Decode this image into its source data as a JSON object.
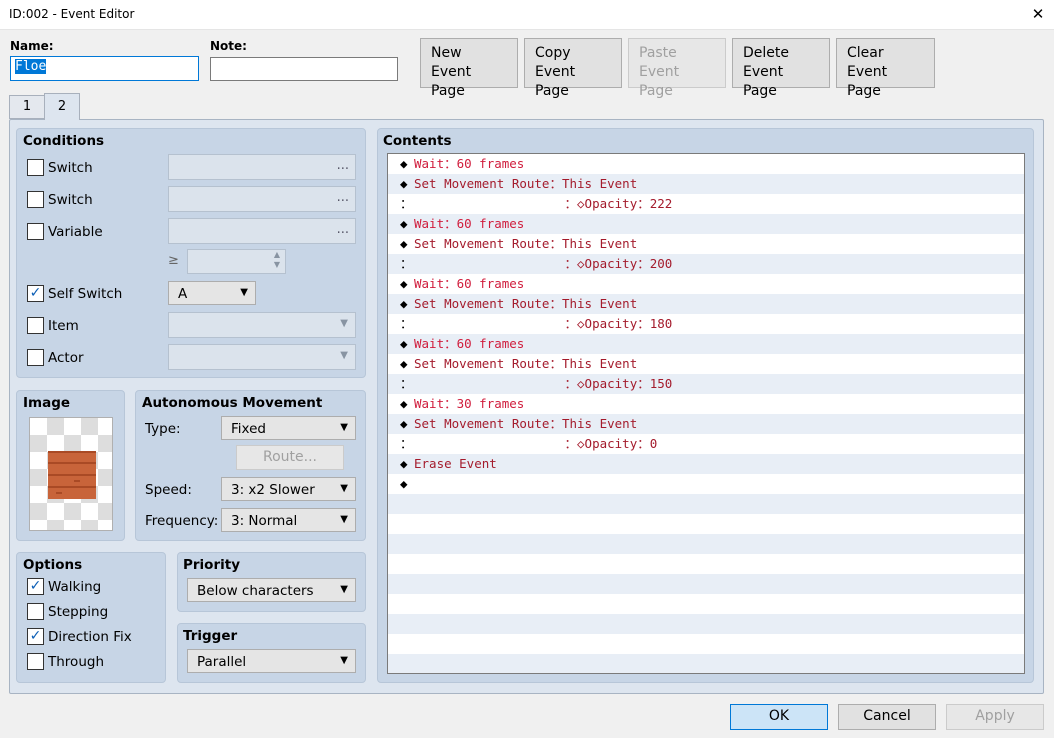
{
  "window": {
    "title": "ID:002 - Event Editor",
    "close_glyph": "✕"
  },
  "name": {
    "label": "Name:",
    "value": "Floe"
  },
  "note": {
    "label": "Note:",
    "value": ""
  },
  "toolbar": {
    "new": [
      "New",
      "Event Page"
    ],
    "copy": [
      "Copy",
      "Event Page"
    ],
    "paste": [
      "Paste",
      "Event Page"
    ],
    "delete": [
      "Delete",
      "Event Page"
    ],
    "clear": [
      "Clear",
      "Event Page"
    ]
  },
  "tabs": [
    "1",
    "2"
  ],
  "conditions": {
    "title": "Conditions",
    "switch1": {
      "label": "Switch",
      "checked": false
    },
    "switch2": {
      "label": "Switch",
      "checked": false
    },
    "variable": {
      "label": "Variable",
      "checked": false
    },
    "ge_symbol": "≥",
    "self_switch": {
      "label": "Self Switch",
      "checked": true,
      "value": "A"
    },
    "item": {
      "label": "Item",
      "checked": false
    },
    "actor": {
      "label": "Actor",
      "checked": false
    },
    "ellipsis": "..."
  },
  "image": {
    "title": "Image"
  },
  "autonomous": {
    "title": "Autonomous Movement",
    "type_label": "Type:",
    "type_value": "Fixed",
    "route_label": "Route...",
    "speed_label": "Speed:",
    "speed_value": "3: x2 Slower",
    "freq_label": "Frequency:",
    "freq_value": "3: Normal"
  },
  "options": {
    "title": "Options",
    "walking": {
      "label": "Walking",
      "checked": true
    },
    "stepping": {
      "label": "Stepping",
      "checked": false
    },
    "direction_fix": {
      "label": "Direction Fix",
      "checked": true
    },
    "through": {
      "label": "Through",
      "checked": false
    }
  },
  "priority": {
    "title": "Priority",
    "value": "Below characters"
  },
  "trigger": {
    "title": "Trigger",
    "value": "Parallel"
  },
  "contents": {
    "title": "Contents",
    "rows": [
      {
        "d": "◆",
        "t": "Wait：60 frames",
        "c": "red"
      },
      {
        "d": "◆",
        "t": "Set Movement Route：This Event",
        "c": "dark"
      },
      {
        "d": "：",
        "t": "                    ：◇Opacity：222",
        "c": "dark"
      },
      {
        "d": "◆",
        "t": "Wait：60 frames",
        "c": "red"
      },
      {
        "d": "◆",
        "t": "Set Movement Route：This Event",
        "c": "dark"
      },
      {
        "d": "：",
        "t": "                    ：◇Opacity：200",
        "c": "dark"
      },
      {
        "d": "◆",
        "t": "Wait：60 frames",
        "c": "red"
      },
      {
        "d": "◆",
        "t": "Set Movement Route：This Event",
        "c": "dark"
      },
      {
        "d": "：",
        "t": "                    ：◇Opacity：180",
        "c": "dark"
      },
      {
        "d": "◆",
        "t": "Wait：60 frames",
        "c": "red"
      },
      {
        "d": "◆",
        "t": "Set Movement Route：This Event",
        "c": "dark"
      },
      {
        "d": "：",
        "t": "                    ：◇Opacity：150",
        "c": "dark"
      },
      {
        "d": "◆",
        "t": "Wait：30 frames",
        "c": "red"
      },
      {
        "d": "◆",
        "t": "Set Movement Route：This Event",
        "c": "dark"
      },
      {
        "d": "：",
        "t": "                    ：◇Opacity：0",
        "c": "dark"
      },
      {
        "d": "◆",
        "t": "Erase Event",
        "c": "dark"
      },
      {
        "d": "◆",
        "t": "",
        "c": "dark"
      }
    ]
  },
  "buttons": {
    "ok": "OK",
    "cancel": "Cancel",
    "apply": "Apply"
  },
  "colors": {
    "accent": "#0078d7",
    "panel": "#c7d5e6",
    "command_red": "#d01c3c",
    "command_dark": "#a41b2c"
  }
}
